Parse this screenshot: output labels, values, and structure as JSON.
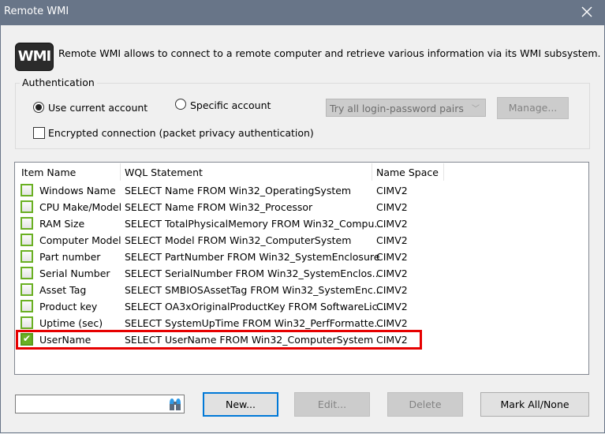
{
  "window": {
    "title": "Remote WMI",
    "close_icon": "close-icon"
  },
  "intro": {
    "logo_text": "WMI",
    "description": "Remote WMI allows to connect to a remote computer and retrieve various information via its WMI subsystem."
  },
  "authentication": {
    "group_label": "Authentication",
    "use_current_account": {
      "label": "Use current account",
      "checked": true
    },
    "specific_account": {
      "label": "Specific account",
      "checked": false
    },
    "encrypted_connection": {
      "label": "Encrypted connection (packet privacy authentication)",
      "checked": false
    },
    "login_combo": {
      "value": "Try all login-password pairs",
      "enabled": false
    },
    "manage_button": {
      "label": "Manage...",
      "enabled": false
    }
  },
  "list": {
    "columns": [
      "Item Name",
      "WQL Statement",
      "Name Space"
    ],
    "rows": [
      {
        "checked": false,
        "name": "Windows Name",
        "wql": "SELECT Name FROM Win32_OperatingSystem",
        "ns": "CIMV2"
      },
      {
        "checked": false,
        "name": "CPU Make/Model",
        "wql": "SELECT Name FROM Win32_Processor",
        "ns": "CIMV2"
      },
      {
        "checked": false,
        "name": "RAM Size",
        "wql": "SELECT TotalPhysicalMemory FROM Win32_Compu...",
        "ns": "CIMV2"
      },
      {
        "checked": false,
        "name": "Computer Model",
        "wql": "SELECT Model FROM Win32_ComputerSystem",
        "ns": "CIMV2"
      },
      {
        "checked": false,
        "name": "Part number",
        "wql": "SELECT PartNumber FROM Win32_SystemEnclosure",
        "ns": "CIMV2"
      },
      {
        "checked": false,
        "name": "Serial Number",
        "wql": "SELECT SerialNumber FROM Win32_SystemEnclos...",
        "ns": "CIMV2"
      },
      {
        "checked": false,
        "name": "Asset Tag",
        "wql": "SELECT SMBIOSAssetTag FROM Win32_SystemEnc...",
        "ns": "CIMV2"
      },
      {
        "checked": false,
        "name": "Product key",
        "wql": "SELECT OA3xOriginalProductKey FROM SoftwareLic...",
        "ns": "CIMV2"
      },
      {
        "checked": false,
        "name": "Uptime (sec)",
        "wql": "SELECT SystemUpTime FROM Win32_PerfFormatte...",
        "ns": "CIMV2"
      },
      {
        "checked": true,
        "name": "UserName",
        "wql": "SELECT UserName FROM Win32_ComputerSystem",
        "ns": "CIMV2"
      }
    ],
    "highlight_color": "#e60000"
  },
  "footer": {
    "search_value": "",
    "search_icon": "binoculars-icon",
    "new_button": "New...",
    "edit_button": "Edit...",
    "delete_button": "Delete",
    "mark_button": "Mark All/None"
  }
}
